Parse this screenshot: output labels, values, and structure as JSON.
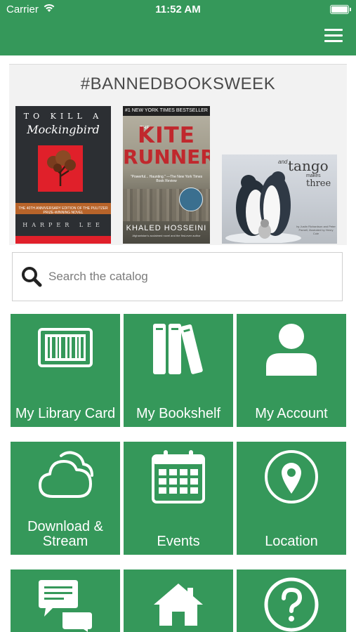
{
  "status_bar": {
    "carrier": "Carrier",
    "time": "11:52 AM"
  },
  "nav": {
    "menu_icon": "hamburger-menu-icon"
  },
  "banner": {
    "title": "#BANNEDBOOKSWEEK",
    "books": [
      {
        "line1": "TO KILL A",
        "line2": "Mockingbird",
        "band": "THE 40TH ANNIVERSARY EDITION OF THE PULITZER PRIZE-WINNING NOVEL",
        "author": "HARPER LEE"
      },
      {
        "top": "#1 NEW YORK TIMES BESTSELLER",
        "the": "THE",
        "line1": "KITE",
        "line2": "RUNNER",
        "quote": "\"Powerful... Haunting.\" —The New York Times Book Review",
        "author": "KHALED HOSSEINI",
        "small": "Afghanistan's acclaimed novel and the first-ever author"
      },
      {
        "and": "and",
        "line1": "tango",
        "line2": "makes",
        "line3": "three",
        "credit": "by Justin Richardson and Peter Parnell, illustrated by Henry Cole"
      }
    ]
  },
  "search": {
    "placeholder": "Search the catalog",
    "icon": "search-icon"
  },
  "tiles": [
    {
      "label": "My Library Card",
      "icon": "library-card-icon"
    },
    {
      "label": "My Bookshelf",
      "icon": "bookshelf-icon"
    },
    {
      "label": "My Account",
      "icon": "account-icon"
    },
    {
      "label": "Download & Stream",
      "label_line1": "Download &",
      "label_line2": "Stream",
      "icon": "cloud-icon"
    },
    {
      "label": "Events",
      "icon": "calendar-icon"
    },
    {
      "label": "Location",
      "icon": "location-pin-icon"
    },
    {
      "label": "",
      "icon": "chat-icon"
    },
    {
      "label": "",
      "icon": "home-icon"
    },
    {
      "label": "",
      "icon": "help-icon"
    }
  ],
  "colors": {
    "brand_green": "#35985a",
    "banner_bg": "#f2f2f2"
  }
}
